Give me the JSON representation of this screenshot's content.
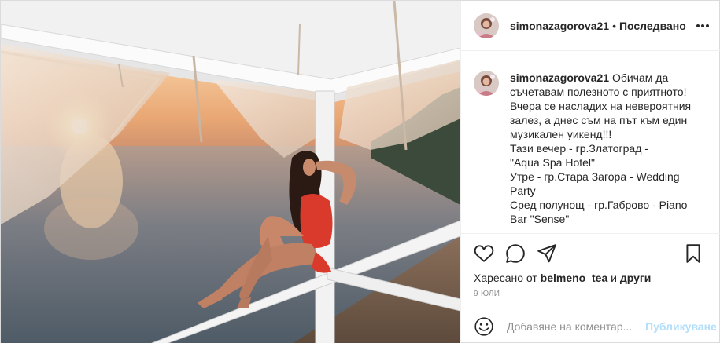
{
  "post": {
    "username": "simonazagorova21",
    "separator": "•",
    "follow_state": "Последвано",
    "more_icon": "more-horizontal-icon",
    "photo_alt": "Woman in red swimsuit sitting on railing at seaside sunset"
  },
  "caption": {
    "username": "simonazagorova21",
    "lines": [
      "Обичам да",
      "съчетавам полезното с приятното!",
      "Вчера се насладих на невероятния",
      "залез, а днес съм на път към един",
      "музикален уикенд!!!",
      "Тази вечер - гр.Златоград -",
      "\"Aqua Spa Hotel\"",
      "Утре - гр.Стара Загора - Wedding",
      "Party",
      "Сред полунощ - гр.Габрово - Piano",
      "Bar \"Sense\""
    ]
  },
  "actions": {
    "like_icon": "heart-icon",
    "comment_icon": "comment-icon",
    "share_icon": "share-icon",
    "save_icon": "bookmark-icon"
  },
  "likes": {
    "prefix": "Харесано от",
    "user": "belmeno_tea",
    "joiner": "и",
    "others": "други"
  },
  "date": "9 юли",
  "comment": {
    "emoji_icon": "emoji-icon",
    "placeholder": "Добавяне на коментар...",
    "publish_label": "Публикуване"
  },
  "colors": {
    "text": "#262626",
    "muted": "#8e8e8e",
    "publish_disabled": "#b2dffc",
    "border": "#efefef"
  }
}
